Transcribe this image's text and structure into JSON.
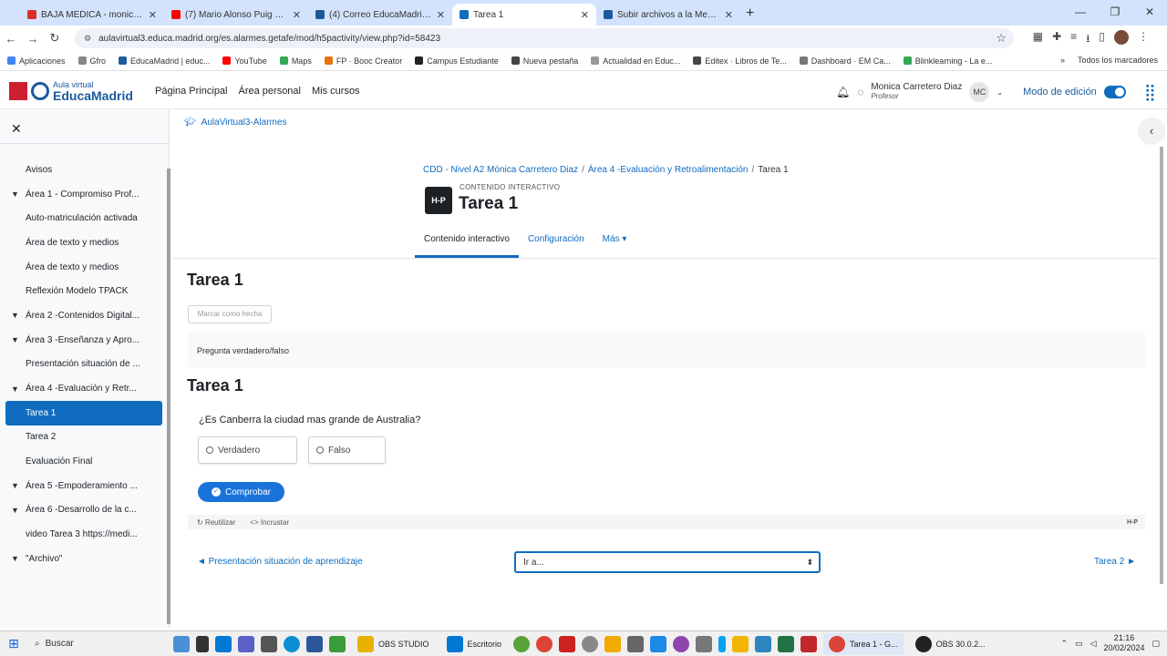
{
  "browser": {
    "tabs": [
      {
        "title": "BAJA MEDICA - monicarera@...",
        "color": "#d93025",
        "active": false
      },
      {
        "title": "(7) Mario Alonso Puig 2024 Tod...",
        "color": "#ff0000",
        "active": false
      },
      {
        "title": "(4) Correo EducaMadrid :: Entr...",
        "color": "#1d5a9c",
        "active": false
      },
      {
        "title": "Tarea 1",
        "color": "#0f6cbf",
        "active": true
      },
      {
        "title": "Subir archivos a la Mediateca |...",
        "color": "#1d5a9c",
        "active": false
      }
    ],
    "new_tab": "+",
    "url": "aulavirtual3.educa.madrid.org/es.alarmes.getafe/mod/h5pactivity/view.php?id=58423",
    "bookmarks": [
      {
        "label": "Aplicaciones",
        "color": "#4285f4"
      },
      {
        "label": "Gfro",
        "color": "#888888"
      },
      {
        "label": "EducaMadrid | educ...",
        "color": "#1d5a9c"
      },
      {
        "label": "YouTube",
        "color": "#ff0000"
      },
      {
        "label": "Maps",
        "color": "#34a853"
      },
      {
        "label": "FP · Booc Creator",
        "color": "#e8710a"
      },
      {
        "label": "Campus Estudiante",
        "color": "#222222"
      },
      {
        "label": "Nueva pestaña",
        "color": "#444444"
      },
      {
        "label": "Actualidad en Educ...",
        "color": "#999999"
      },
      {
        "label": "Editex · Libros de Te...",
        "color": "#444444"
      },
      {
        "label": "Dashboard · EM Ca...",
        "color": "#777777"
      },
      {
        "label": "Blinklearning - La e...",
        "color": "#34a853"
      }
    ],
    "bookmarks_right": "Todos los marcadores"
  },
  "header": {
    "logo_small": "Aula virtual",
    "logo_big": "EducaMadrid",
    "nav": [
      "Página Principal",
      "Área personal",
      "Mis cursos"
    ],
    "user_name": "Monica Carretero Diaz",
    "user_role": "Profesor",
    "user_initials": "MC",
    "edit_mode_label": "Modo de edición"
  },
  "sidebar": {
    "items": [
      {
        "label": "Avisos",
        "type": "item"
      },
      {
        "label": "Área 1 - Compromiso Prof...",
        "type": "section"
      },
      {
        "label": "Auto-matriculación activada",
        "type": "item"
      },
      {
        "label": "Área de texto y medios",
        "type": "item"
      },
      {
        "label": "Área de texto y medios",
        "type": "item"
      },
      {
        "label": "Reflexión Modelo TPACK",
        "type": "item"
      },
      {
        "label": "Área 2 -Contenidos Digital...",
        "type": "section"
      },
      {
        "label": "Área 3 -Enseñanza y Apro...",
        "type": "section"
      },
      {
        "label": "Presentación situación de ...",
        "type": "item"
      },
      {
        "label": "Área 4 -Evaluación y Retr...",
        "type": "section"
      },
      {
        "label": "Tarea 1",
        "type": "active"
      },
      {
        "label": "Tarea 2",
        "type": "item"
      },
      {
        "label": "Evaluación Final",
        "type": "item"
      },
      {
        "label": "Área 5 -Empoderamiento ...",
        "type": "section"
      },
      {
        "label": "Área 6 -Desarrollo de la c...",
        "type": "section"
      },
      {
        "label": "video Tarea 3 https://medi...",
        "type": "item"
      },
      {
        "label": "\"Archivo\"",
        "type": "section"
      }
    ]
  },
  "main": {
    "site_link": "AulaVirtual3-Alarmes",
    "breadcrumb": [
      "CDD - Nivel A2 Mónica Carretero Diaz",
      "Área 4 -Evaluación y Retroalimentación",
      "Tarea 1"
    ],
    "activity_type": "CONTENIDO INTERACTIVO",
    "h5p_badge": "H-P",
    "title": "Tarea 1",
    "tabs": [
      "Contenido interactivo",
      "Configuración",
      "Más ▾"
    ],
    "content_title": "Tarea 1",
    "mark_done": "Marcar como hecha",
    "description": "Pregunta verdadero/falso",
    "h5p_title": "Tarea 1",
    "question": "¿Es Canberra la ciudad mas grande de Australia?",
    "answers": [
      "Verdadero",
      "Falso"
    ],
    "check": "Comprobar",
    "footer_reuse": "Reutilizar",
    "footer_embed": "Incrustar",
    "footer_brand": "H-P",
    "prev": "◄ Presentación situación de aprendizaje",
    "jump": "Ir a...",
    "next": "Tarea 2 ►"
  },
  "taskbar": {
    "search": "Buscar",
    "apps": [
      "OBS STUDIO",
      "Escritorio",
      "Tarea 1 - G...",
      "OBS 30.0.2..."
    ],
    "time": "21:16",
    "date": "20/02/2024"
  }
}
